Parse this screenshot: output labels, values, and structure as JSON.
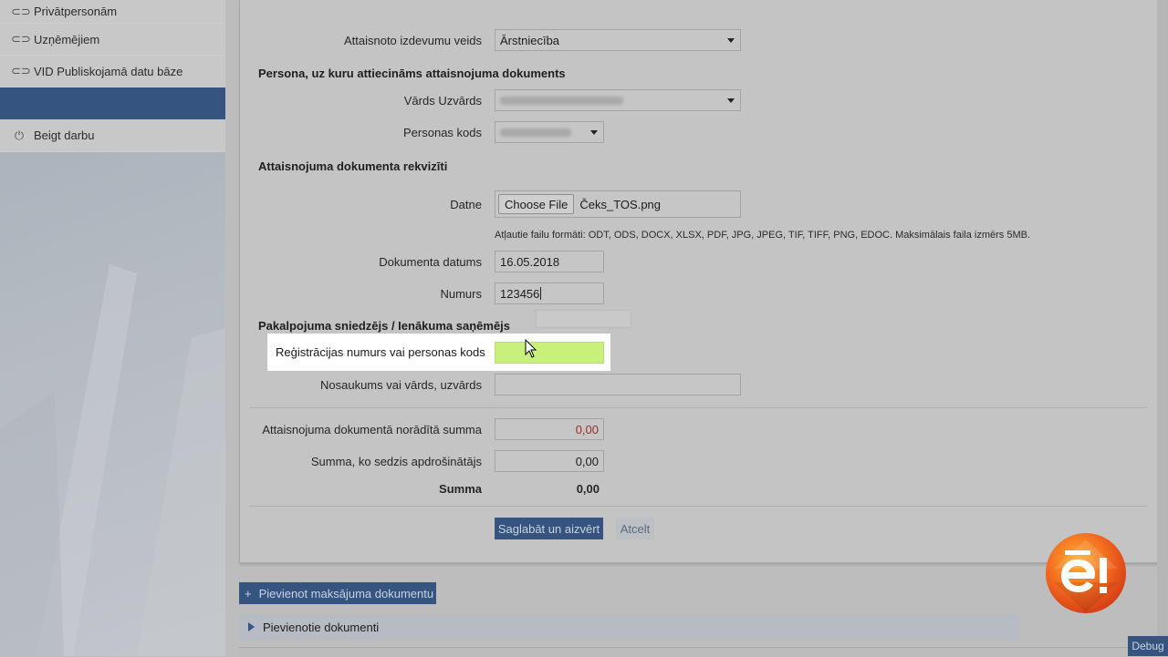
{
  "sidebar": {
    "items": [
      {
        "label": "Privātpersonām",
        "icon": "link-icon"
      },
      {
        "label": "Uzņēmējiem",
        "icon": "link-icon"
      },
      {
        "label": "VID Publiskojamā datu bāze",
        "icon": "link-icon"
      },
      {
        "label": "",
        "icon": ""
      },
      {
        "label": "Beigt darbu",
        "icon": "power-icon"
      }
    ]
  },
  "form": {
    "expense_type": {
      "label": "Attaisnoto izdevumu veids",
      "value": "Ārstniecība"
    },
    "person_section_title": "Persona, uz kuru attiecināms attaisnojuma dokuments",
    "name": {
      "label": "Vārds Uzvārds"
    },
    "personal_code": {
      "label": "Personas kods"
    },
    "doc_section_title": "Attaisnojuma dokumenta rekvizīti",
    "file": {
      "label": "Datne",
      "button": "Choose File",
      "filename": "Čeks_TOS.png",
      "hint": "Atļautie failu formāti: ODT, ODS, DOCX, XLSX, PDF, JPG, JPEG, TIF, TIFF, PNG, EDOC. Maksimālais faila izmērs 5MB."
    },
    "doc_date": {
      "label": "Dokumenta datums",
      "value": "16.05.2018"
    },
    "number": {
      "label": "Numurs",
      "value": "123456"
    },
    "provider_section_title": "Pakalpojuma sniedzējs / Ienākuma saņēmējs",
    "reg_number": {
      "label": "Reģistrācijas numurs vai personas kods",
      "value": ""
    },
    "provider_name": {
      "label": "Nosaukums vai vārds, uzvārds",
      "value": ""
    },
    "doc_sum": {
      "label": "Attaisnojuma dokumentā norādītā summa",
      "value": "0,00"
    },
    "insurer_sum": {
      "label": "Summa, ko sedzis apdrošinātājs",
      "value": "0,00"
    },
    "total": {
      "label": "Summa",
      "value": "0,00"
    },
    "save_button": "Saglabāt un aizvērt",
    "cancel_button": "Atcelt"
  },
  "add_payment_button": "Pievienot maksājuma dokumentu",
  "attached_docs": "Pievienotie dokumenti",
  "debug_button": "Debug",
  "colors": {
    "accent": "#35547f",
    "highlight_input": "#c9f07a",
    "logo_orange": "#f0641e"
  }
}
